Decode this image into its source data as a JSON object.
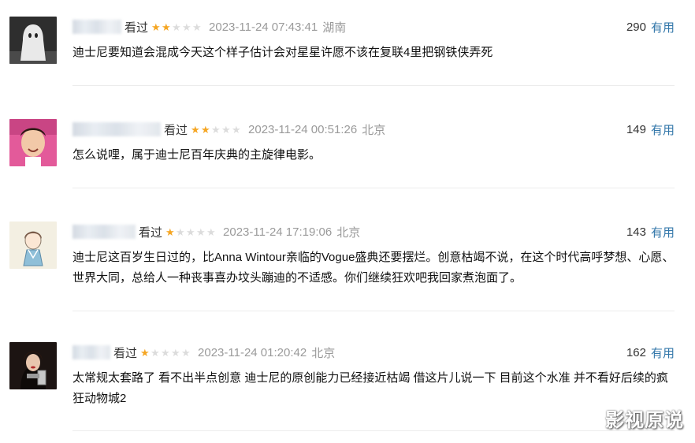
{
  "reviews": [
    {
      "watched_label": "看过",
      "rating": 2,
      "max_rating": 5,
      "timestamp": "2023-11-24 07:43:41",
      "location": "湖南",
      "votes": "290",
      "useful_label": "有用",
      "content": "迪士尼要知道会混成今天这个样子估计会对星星许愿不该在复联4里把钢铁侠弄死"
    },
    {
      "watched_label": "看过",
      "rating": 2,
      "max_rating": 5,
      "timestamp": "2023-11-24 00:51:26",
      "location": "北京",
      "votes": "149",
      "useful_label": "有用",
      "content": "怎么说哩，属于迪士尼百年庆典的主旋律电影。"
    },
    {
      "watched_label": "看过",
      "rating": 1,
      "max_rating": 5,
      "timestamp": "2023-11-24 17:19:06",
      "location": "北京",
      "votes": "143",
      "useful_label": "有用",
      "content": "迪士尼这百岁生日过的，比Anna Wintour亲临的Vogue盛典还要摆烂。创意枯竭不说，在这个时代高呼梦想、心愿、世界大同，总给人一种丧事喜办坟头蹦迪的不适感。你们继续狂欢吧我回家煮泡面了。"
    },
    {
      "watched_label": "看过",
      "rating": 1,
      "max_rating": 5,
      "timestamp": "2023-11-24 01:20:42",
      "location": "北京",
      "votes": "162",
      "useful_label": "有用",
      "content": "太常规太套路了 看不出半点创意 迪士尼的原创能力已经接近枯竭 借这片儿说一下 目前这个水准 并不看好后续的疯狂动物城2"
    }
  ],
  "watermark": "影视原说"
}
